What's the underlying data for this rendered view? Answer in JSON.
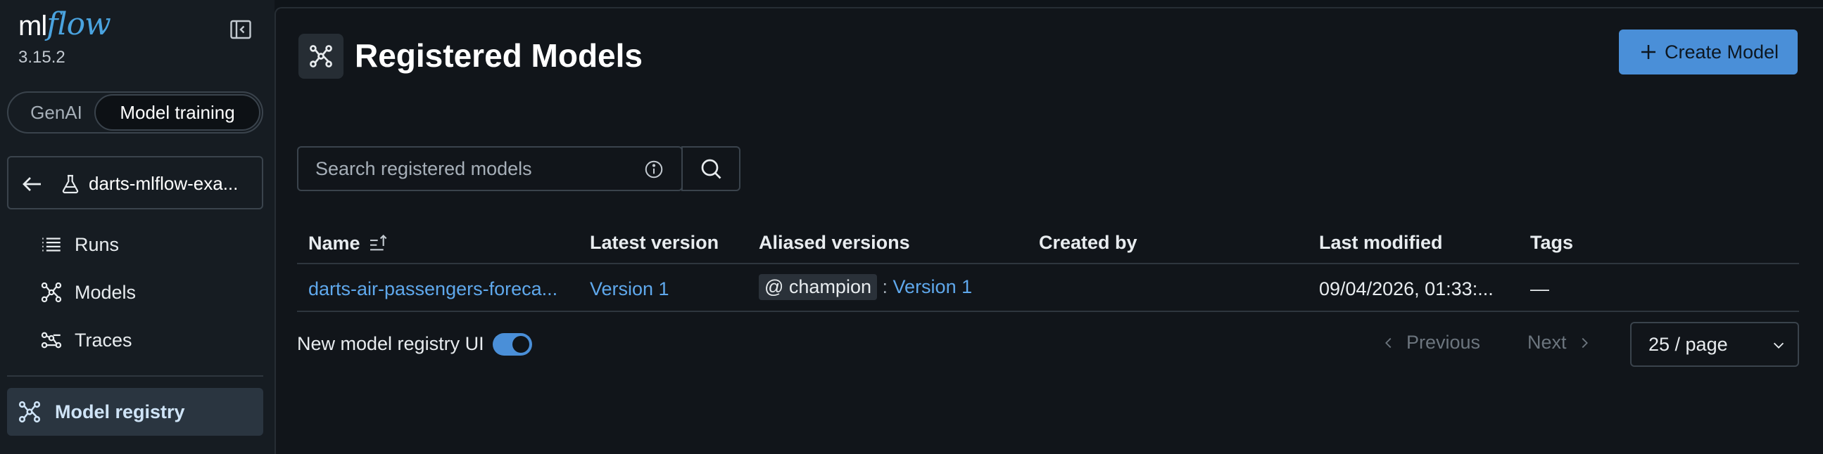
{
  "sidebar": {
    "logo_ml": "ml",
    "logo_flow": "flow",
    "version": "3.15.2",
    "segments": {
      "genai": "GenAI",
      "model_training": "Model training",
      "selected": "Model training"
    },
    "experiment_name": "darts-mlflow-exa...",
    "nav": [
      {
        "label": "Runs",
        "icon": "list-icon"
      },
      {
        "label": "Models",
        "icon": "models-icon"
      },
      {
        "label": "Traces",
        "icon": "traces-icon"
      }
    ],
    "registry_label": "Model registry"
  },
  "header": {
    "title": "Registered Models",
    "create_label": "Create Model"
  },
  "search": {
    "placeholder": "Search registered models"
  },
  "table": {
    "columns": [
      "Name",
      "Latest version",
      "Aliased versions",
      "Created by",
      "Last modified",
      "Tags"
    ],
    "rows": [
      {
        "name": "darts-air-passengers-foreca...",
        "latest_version": "Version 1",
        "alias": "@ champion",
        "alias_sep": ":",
        "alias_version": "Version 1",
        "created_by": "",
        "last_modified": "09/04/2026, 01:33:...",
        "tags": "—"
      }
    ]
  },
  "footer": {
    "toggle_label": "New model registry UI",
    "toggle_on": true,
    "previous": "Previous",
    "next": "Next",
    "page_size": "25 / page"
  },
  "colors": {
    "accent": "#4a8fd8",
    "link": "#5fa8ec",
    "background": "#11151a"
  }
}
